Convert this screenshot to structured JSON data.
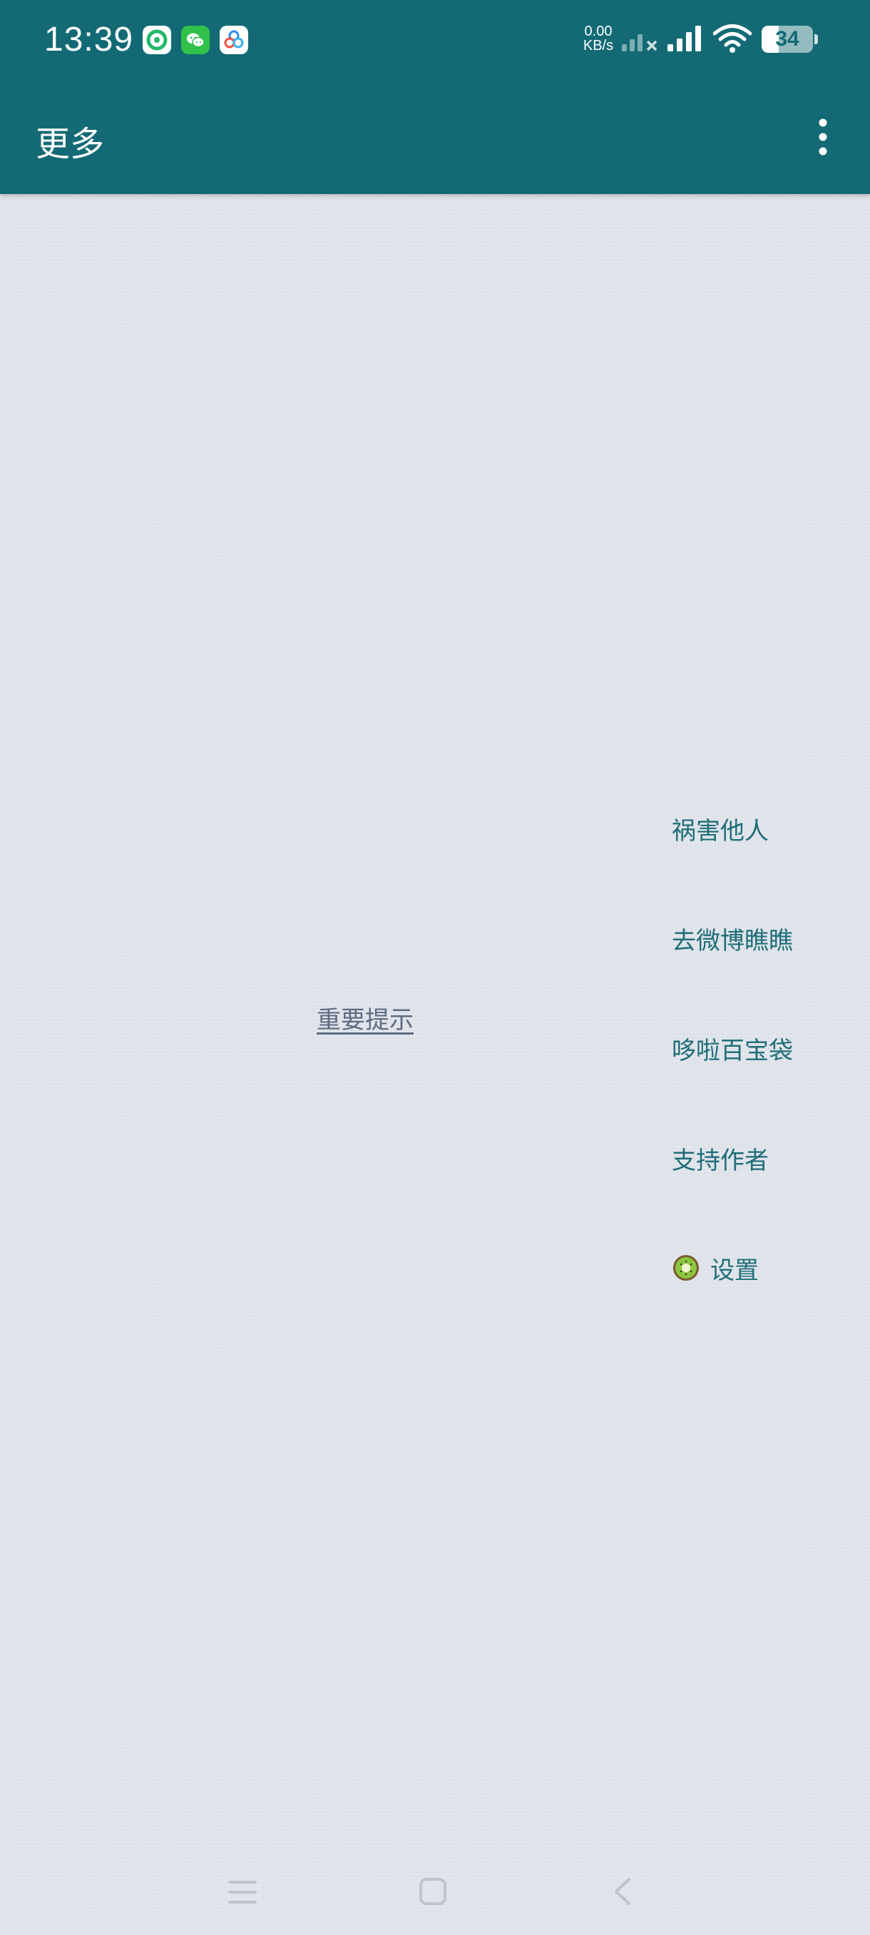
{
  "status_bar": {
    "time": "13:39",
    "net_speed_value": "0.00",
    "net_speed_unit": "KB/s",
    "battery_level": "34",
    "battery_fraction": 0.34,
    "notification_icons": [
      "app-green-icon",
      "wechat-icon",
      "baidu-netdisk-icon"
    ]
  },
  "app_bar": {
    "title": "更多",
    "overflow_icon": "more-vert-icon"
  },
  "content": {
    "notice_link": "重要提示"
  },
  "menu": {
    "items": [
      {
        "label": "祸害他人"
      },
      {
        "label": "去微博瞧瞧"
      },
      {
        "label": "哆啦百宝袋"
      },
      {
        "label": "支持作者"
      },
      {
        "label": "设置",
        "icon": "kiwi-icon"
      }
    ]
  },
  "colors": {
    "primary": "#136a74",
    "background": "#dfe3ea",
    "menu_text": "#1f6e78",
    "link_text": "#5d6a80"
  }
}
